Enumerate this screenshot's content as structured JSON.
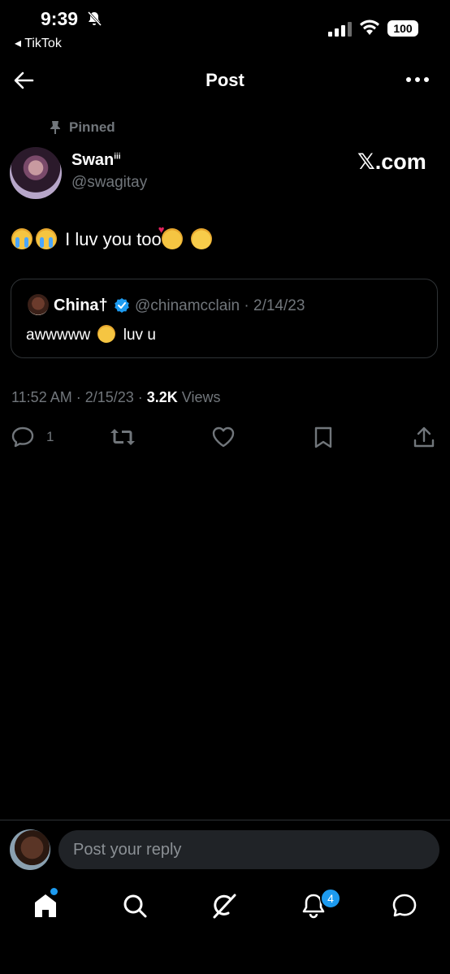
{
  "status_bar": {
    "time": "9:39",
    "back_app": "◂ TikTok",
    "battery": "100"
  },
  "header": {
    "title": "Post"
  },
  "post": {
    "pinned_label": "Pinned",
    "author": {
      "name": "Swan",
      "name_suffix": "iii",
      "handle": "@swagitay"
    },
    "watermark": "𝕏.com",
    "text": "I luv you too",
    "quote": {
      "name": "China†",
      "handle_date": "@chinamcclain · 2/14/23",
      "text_before": "awwwww",
      "text_after": "luv u"
    },
    "meta": {
      "time_date": "11:52 AM · 2/15/23 · ",
      "views_count": "3.2K",
      "views_label": " Views"
    },
    "actions": {
      "reply_count": "1"
    }
  },
  "composer": {
    "placeholder": "Post your reply"
  },
  "nav": {
    "notifications_badge": "4"
  },
  "colors": {
    "background": "#000000",
    "accent": "#1d9bf0",
    "muted": "#71767b"
  }
}
